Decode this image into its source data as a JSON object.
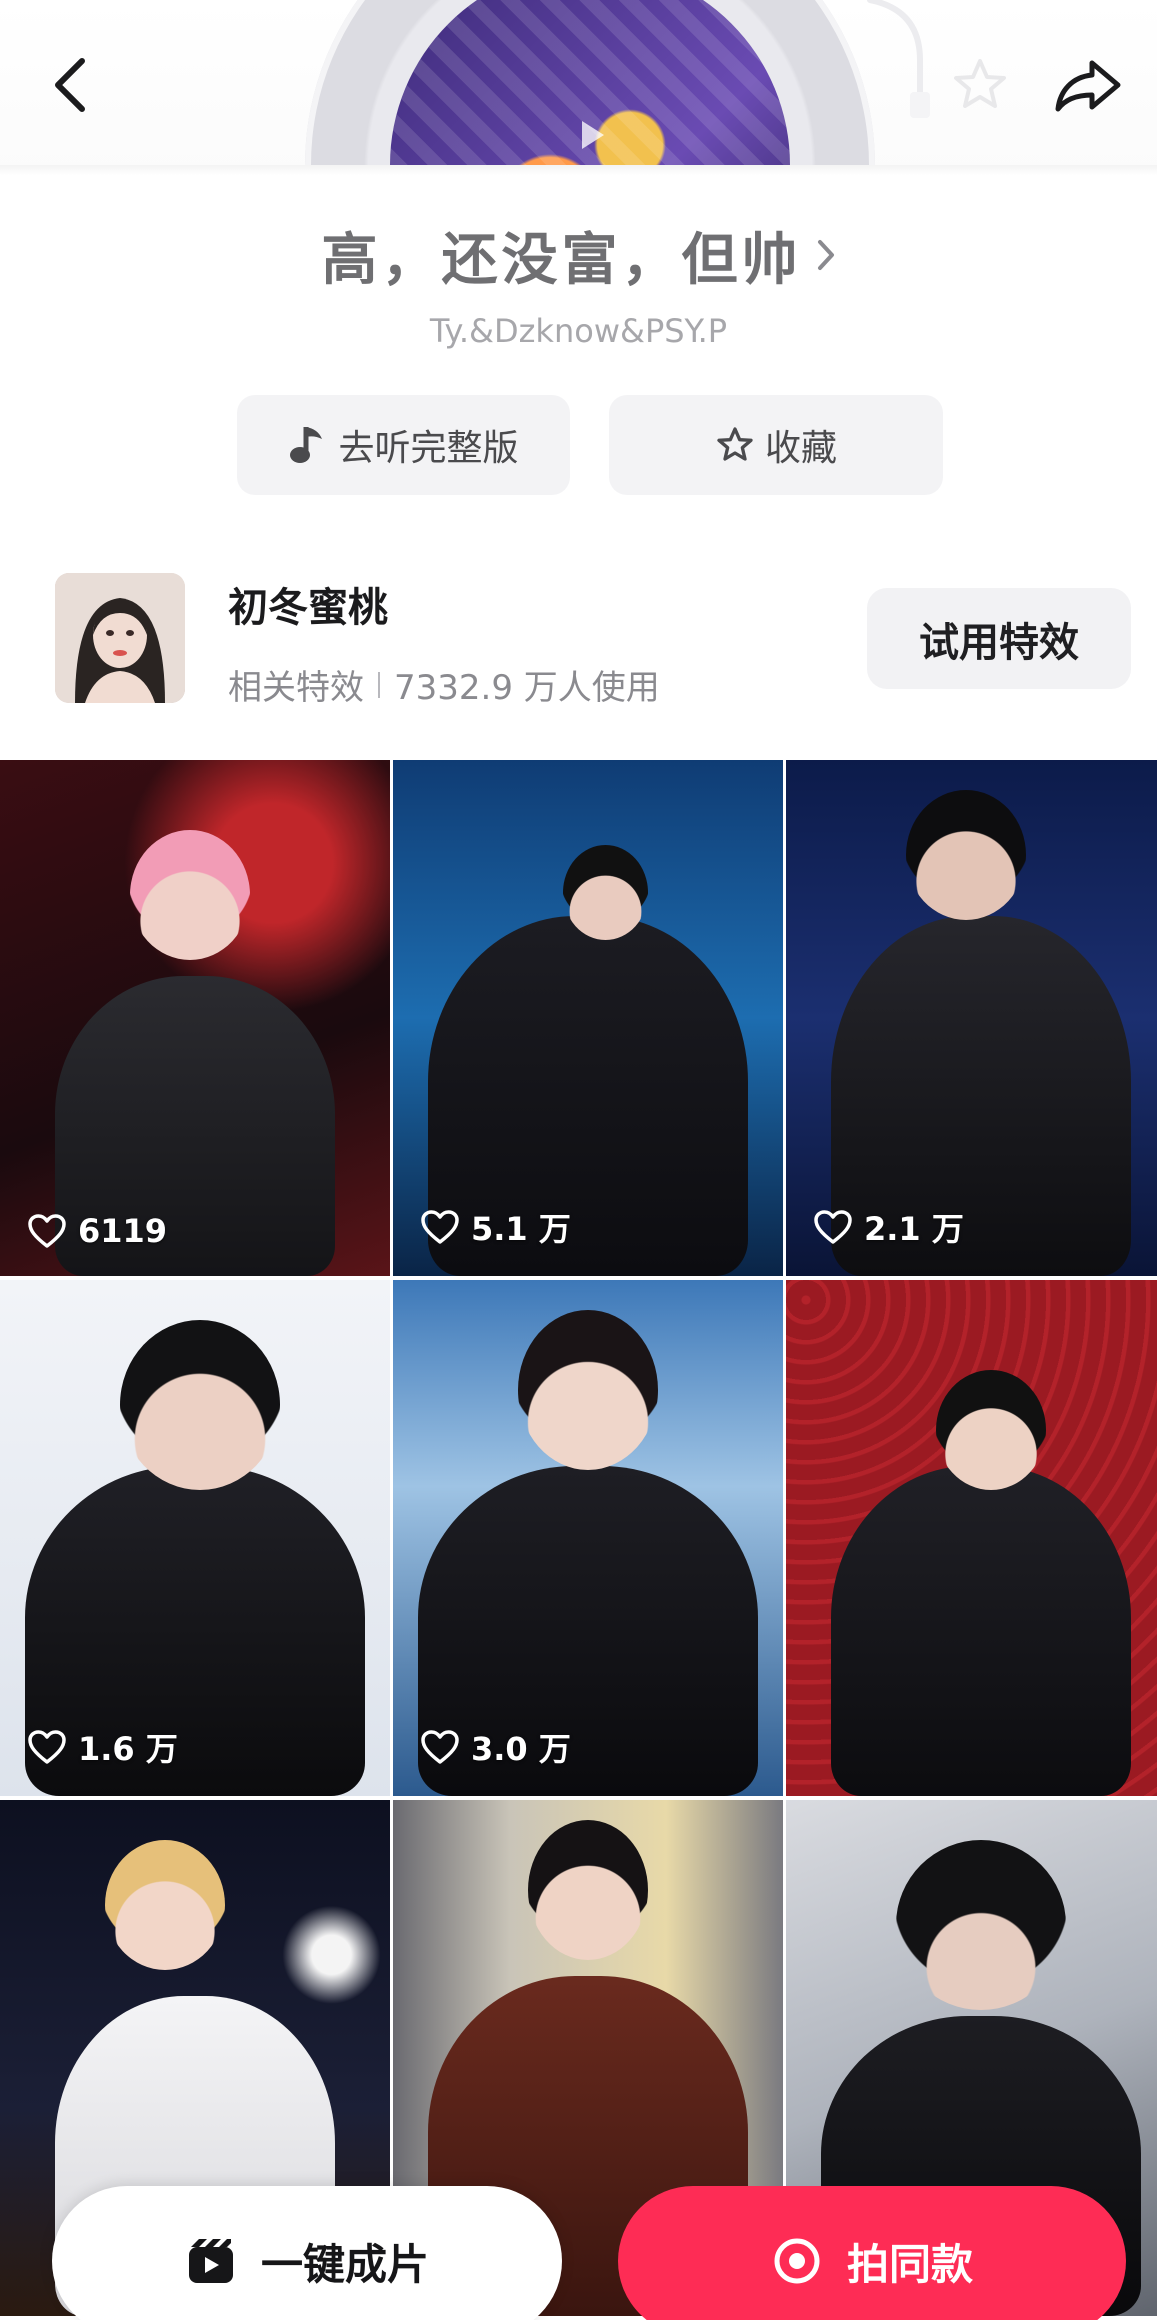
{
  "header": {
    "back_icon": "chevron-left-icon",
    "favorite_icon": "star-outline-icon",
    "share_icon": "share-arrow-icon"
  },
  "song": {
    "title": "高，还没富，但帅",
    "artist": "Ty.&Dzknow&PSY.P",
    "listen_full_label": "去听完整版",
    "collect_label": "收藏"
  },
  "effect": {
    "name": "初冬蜜桃",
    "category": "相关特效",
    "usage": "7332.9 万人使用",
    "try_label": "试用特效"
  },
  "videos": [
    {
      "likes": "6119"
    },
    {
      "likes": "5.1 万"
    },
    {
      "likes": "2.1 万"
    },
    {
      "likes": "1.6 万"
    },
    {
      "likes": "3.0 万"
    },
    {
      "likes": ""
    },
    {
      "likes": ""
    },
    {
      "likes": ""
    },
    {
      "likes": ""
    }
  ],
  "bottom_bar": {
    "one_click_label": "一键成片",
    "shoot_same_label": "拍同款"
  },
  "colors": {
    "accent": "#fe2c55",
    "title_gray": "#6f6f72",
    "button_bg": "#f3f3f5"
  }
}
